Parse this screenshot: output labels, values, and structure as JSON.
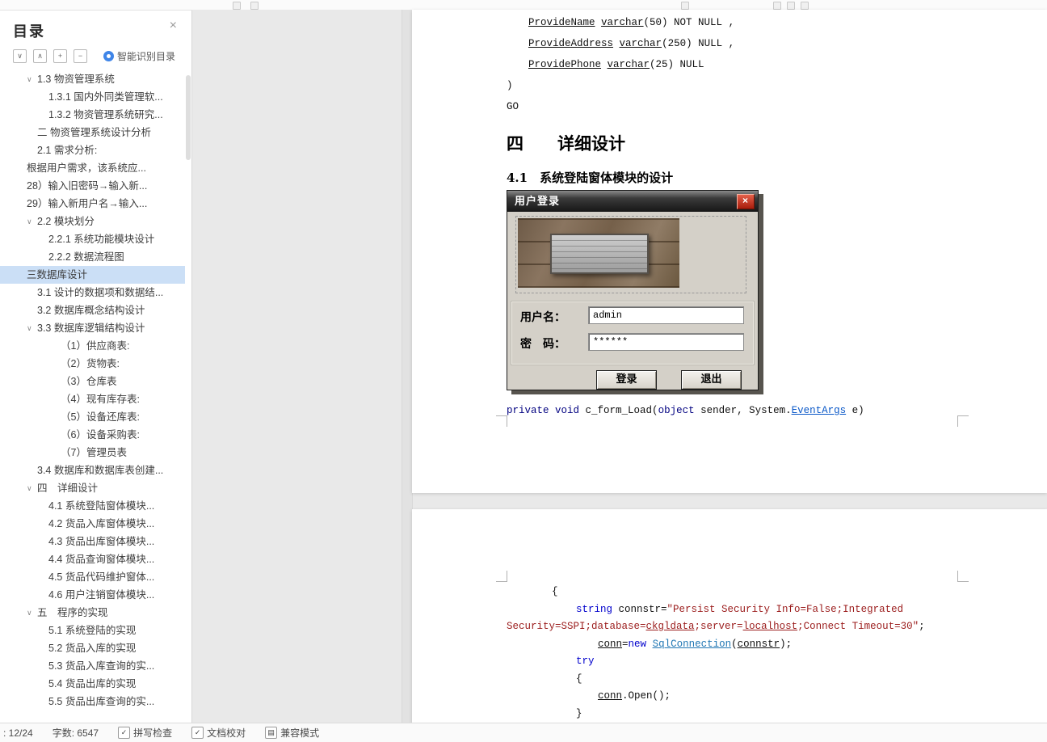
{
  "colors": {
    "toc_selected_bg": "#cbdff6",
    "code_string": "#9b1c1c",
    "code_keyword": "#0000cc",
    "hyperlink": "#0a58c8",
    "dialog_titlebar": "#2b2b2b",
    "smart_icon_blue": "#3f85e8"
  },
  "toolbar": {
    "icons": [
      "formatting-mark-icon",
      "formatting-mark-icon",
      "formatting-mark-icon",
      "toolbar-mini-icon",
      "toolbar-mini-icon",
      "toolbar-mini-icon"
    ]
  },
  "sidebar": {
    "title": "目录",
    "close_glyph": "×",
    "toolbar_icons": [
      {
        "name": "collapse-all-icon",
        "glyph": "∨"
      },
      {
        "name": "expand-all-icon",
        "glyph": "∧"
      },
      {
        "name": "expand-level-icon",
        "glyph": "+"
      },
      {
        "name": "collapse-level-icon",
        "glyph": "−"
      }
    ],
    "smart_toc_label": "智能识别目录",
    "items": [
      {
        "label": "1.3 物资管理系统",
        "indent": 1,
        "arrow": true
      },
      {
        "label": "1.3.1 国内外同类管理软...",
        "indent": 2
      },
      {
        "label": "1.3.2 物资管理系统研究...",
        "indent": 2
      },
      {
        "label": "二 物资管理系统设计分析",
        "indent": 1
      },
      {
        "label": "2.1 需求分析:",
        "indent": 1
      },
      {
        "label": "根据用户需求，该系统应...",
        "indent": 0
      },
      {
        "label": "28）输入旧密码→输入新...",
        "indent": 0
      },
      {
        "label": "29）输入新用户名→输入...",
        "indent": 0
      },
      {
        "label": "2.2 模块划分",
        "indent": 1,
        "arrow": true
      },
      {
        "label": "2.2.1 系统功能模块设计",
        "indent": 2
      },
      {
        "label": "2.2.2 数据流程图",
        "indent": 2
      },
      {
        "label": "三数据库设计",
        "indent": 0,
        "selected": true
      },
      {
        "label": "3.1 设计的数据项和数据结...",
        "indent": 1
      },
      {
        "label": "3.2 数据库概念结构设计",
        "indent": 1
      },
      {
        "label": "3.3 数据库逻辑结构设计",
        "indent": 1,
        "arrow": true
      },
      {
        "label": "（1）供应商表:",
        "indent": 3
      },
      {
        "label": "（2）货物表:",
        "indent": 3
      },
      {
        "label": "（3）仓库表",
        "indent": 3
      },
      {
        "label": "（4）现有库存表:",
        "indent": 3
      },
      {
        "label": "（5）设备还库表:",
        "indent": 3
      },
      {
        "label": "（6）设备采购表:",
        "indent": 3
      },
      {
        "label": "（7）管理员表",
        "indent": 3
      },
      {
        "label": "3.4 数据库和数据库表创建...",
        "indent": 1
      },
      {
        "label": "四　详细设计",
        "indent": 1,
        "arrow": true
      },
      {
        "label": "4.1 系统登陆窗体模块...",
        "indent": 2
      },
      {
        "label": "4.2 货品入库窗体模块...",
        "indent": 2
      },
      {
        "label": "4.3 货品出库窗体模块...",
        "indent": 2
      },
      {
        "label": "4.4 货品查询窗体模块...",
        "indent": 2
      },
      {
        "label": "4.5 货品代码维护窗体...",
        "indent": 2
      },
      {
        "label": "4.6 用户注销窗体模块...",
        "indent": 2
      },
      {
        "label": "五　程序的实现",
        "indent": 1,
        "arrow": true
      },
      {
        "label": "5.1 系统登陆的实现",
        "indent": 2
      },
      {
        "label": "5.2 货品入库的实现",
        "indent": 2
      },
      {
        "label": "5.3 货品入库查询的实...",
        "indent": 2
      },
      {
        "label": "5.4 货品出库的实现",
        "indent": 2
      },
      {
        "label": "5.5 货品出库查询的实...",
        "indent": 2
      }
    ]
  },
  "document": {
    "page1": {
      "sql_lines": [
        {
          "ind": 27,
          "segs": [
            {
              "t": "ProvideName",
              "u": true
            },
            {
              "t": " "
            },
            {
              "t": "varchar",
              "u": true
            },
            {
              "t": "(50) NOT NULL ,"
            }
          ]
        },
        {
          "ind": 27,
          "segs": [
            {
              "t": "ProvideAddress",
              "u": true
            },
            {
              "t": " "
            },
            {
              "t": "varchar",
              "u": true
            },
            {
              "t": "(250) NULL ,"
            }
          ]
        },
        {
          "ind": 27,
          "segs": [
            {
              "t": "ProvidePhone",
              "u": true
            },
            {
              "t": " "
            },
            {
              "t": "varchar",
              "u": true
            },
            {
              "t": "(25) NULL"
            }
          ]
        },
        {
          "ind": 0,
          "segs": [
            {
              "t": ")"
            }
          ]
        },
        {
          "ind": 0,
          "segs": [
            {
              "t": "GO"
            }
          ]
        }
      ],
      "heading": "四　　详细设计",
      "subheading": "4.1　系统登陆窗体模块的设计",
      "dialog": {
        "title": "用户登录",
        "close_glyph": "×",
        "username_label": "用户名：",
        "username_value": "admin",
        "password_label": "密　码：",
        "password_value": "******",
        "login_label": "登录",
        "exit_label": "退出"
      },
      "code_line": {
        "ind": 0,
        "segs": [
          {
            "t": "private",
            "c": "nav"
          },
          {
            "t": " "
          },
          {
            "t": "void",
            "c": "nav"
          },
          {
            "t": " c_form_Load("
          },
          {
            "t": "object",
            "c": "nav"
          },
          {
            "t": " sender, System."
          },
          {
            "t": "EventArgs",
            "c": "link",
            "u": true
          },
          {
            "t": " e)"
          }
        ]
      }
    },
    "page2": {
      "code_lines": [
        {
          "ind": 56,
          "segs": [
            {
              "t": "{"
            }
          ]
        },
        {
          "ind": 86,
          "segs": [
            {
              "t": "string",
              "c": "blue"
            },
            {
              "t": " connstr="
            },
            {
              "t": "\"Persist Security Info=False;Integrated",
              "c": "red"
            }
          ]
        },
        {
          "ind": 0,
          "segs": [
            {
              "t": "Security=SSPI;database=",
              "c": "red"
            },
            {
              "t": "ckgldata",
              "c": "red",
              "u": true
            },
            {
              "t": ";server=",
              "c": "red"
            },
            {
              "t": "localhost",
              "c": "red",
              "u": true
            },
            {
              "t": ";Connect Timeout=30\"",
              "c": "red"
            },
            {
              "t": ";"
            }
          ]
        },
        {
          "ind": 113,
          "segs": [
            {
              "t": "conn",
              "u": true
            },
            {
              "t": "="
            },
            {
              "t": "new",
              "c": "blue"
            },
            {
              "t": " "
            },
            {
              "t": "SqlConnection",
              "c": "teal",
              "u": true
            },
            {
              "t": "("
            },
            {
              "t": "connstr",
              "u": true
            },
            {
              "t": ");"
            }
          ]
        },
        {
          "ind": 86,
          "segs": [
            {
              "t": "try",
              "c": "blue"
            }
          ]
        },
        {
          "ind": 86,
          "segs": [
            {
              "t": "{"
            }
          ]
        },
        {
          "ind": 113,
          "segs": [
            {
              "t": "conn",
              "u": true
            },
            {
              "t": ".Open();"
            }
          ]
        },
        {
          "ind": 86,
          "segs": [
            {
              "t": "}"
            }
          ]
        }
      ]
    }
  },
  "statusbar": {
    "items": [
      {
        "name": "page-indicator",
        "label": ": 12/24"
      },
      {
        "name": "word-count",
        "label": "字数: 6547"
      },
      {
        "name": "spell-check-toggle",
        "icon": "spell-check-icon",
        "glyph": "✓",
        "label": "拼写检查"
      },
      {
        "name": "doc-proofread-button",
        "icon": "proofread-icon",
        "glyph": "✓",
        "label": "文档校对"
      },
      {
        "name": "compat-mode-indicator",
        "icon": "compat-mode-icon",
        "glyph": "▤",
        "label": "兼容模式"
      }
    ]
  }
}
